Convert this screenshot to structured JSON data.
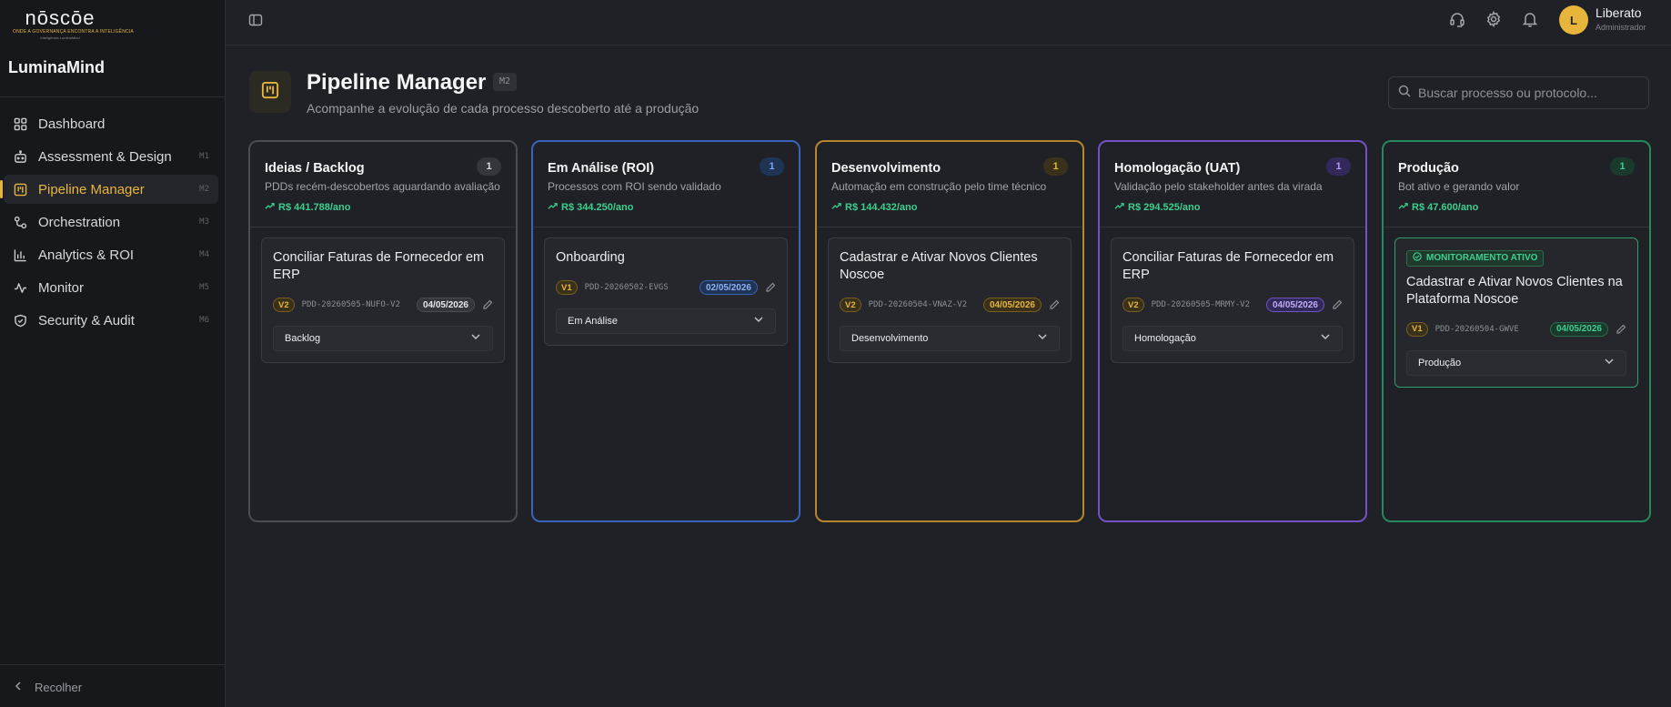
{
  "app": {
    "logo_word": "nōscōe",
    "logo_tagline": "ONDE A GOVERNANÇA ENCONTRA A INTELIGÊNCIA",
    "logo_sub": "Inteligência LuminaMind",
    "brand": "LuminaMind"
  },
  "sidebar": {
    "items": [
      {
        "label": "Dashboard",
        "code": "",
        "icon": "grid-icon"
      },
      {
        "label": "Assessment & Design",
        "code": "M1",
        "icon": "bot-icon"
      },
      {
        "label": "Pipeline Manager",
        "code": "M2",
        "icon": "kanban-icon",
        "active": true
      },
      {
        "label": "Orchestration",
        "code": "M3",
        "icon": "workflow-icon"
      },
      {
        "label": "Analytics & ROI",
        "code": "M4",
        "icon": "bar-chart-icon"
      },
      {
        "label": "Monitor",
        "code": "M5",
        "icon": "activity-icon"
      },
      {
        "label": "Security & Audit",
        "code": "M6",
        "icon": "shield-check-icon"
      }
    ],
    "collapse_label": "Recolher"
  },
  "topbar": {
    "user_initial": "L",
    "user_name": "Liberato",
    "user_role": "Administrador"
  },
  "header": {
    "title": "Pipeline Manager",
    "code": "M2",
    "subtitle": "Acompanhe a evolução de cada processo descoberto até a produção",
    "search_placeholder": "Buscar processo ou protocolo..."
  },
  "columns": [
    {
      "title": "Ideias / Backlog",
      "count": "1",
      "desc": "PDDs recém-descobertos aguardando avaliação",
      "value": "R$ 441.788/ano",
      "border": "#4a4c52",
      "badge_bg": "#34363c",
      "badge_fg": "#d7d9de",
      "card": {
        "tag": "",
        "title": "Conciliar Faturas de Fornecedor em ERP",
        "version": "V2",
        "pdd": "PDD-20260505-NUFO-V2",
        "date": "04/05/2026",
        "stage": "Backlog",
        "date_bg": "#34363c",
        "date_fg": "#e6e7ea",
        "date_border": "#4a4c52"
      }
    },
    {
      "title": "Em Análise (ROI)",
      "count": "1",
      "desc": "Processos com ROI sendo validado",
      "value": "R$ 344.250/ano",
      "border": "#3b64b8",
      "badge_bg": "#1f3355",
      "badge_fg": "#7aa6f2",
      "card": {
        "tag": "",
        "title": "Onboarding",
        "version": "V1",
        "pdd": "PDD-20260502-EVGS",
        "date": "02/05/2026",
        "stage": "Em Análise",
        "date_bg": "#1f3355",
        "date_fg": "#8db3f5",
        "date_border": "#3b64b8"
      }
    },
    {
      "title": "Desenvolvimento",
      "count": "1",
      "desc": "Automação em construção pelo time técnico",
      "value": "R$ 144.432/ano",
      "border": "#b8862a",
      "badge_bg": "#3a311b",
      "badge_fg": "#e8b53b",
      "card": {
        "tag": "",
        "title": "Cadastrar e Ativar Novos Clientes Noscoe",
        "version": "V2",
        "pdd": "PDD-20260504-VNAZ-V2",
        "date": "04/05/2026",
        "stage": "Desenvolvimento",
        "date_bg": "#3a311b",
        "date_fg": "#e8b53b",
        "date_border": "#7a5e21"
      }
    },
    {
      "title": "Homologação (UAT)",
      "count": "1",
      "desc": "Validação pelo stakeholder antes da virada",
      "value": "R$ 294.525/ano",
      "border": "#7452c2",
      "badge_bg": "#32285a",
      "badge_fg": "#b49af2",
      "card": {
        "tag": "",
        "title": "Conciliar Faturas de Fornecedor em ERP",
        "version": "V2",
        "pdd": "PDD-20260505-MRMY-V2",
        "date": "04/05/2026",
        "stage": "Homologação",
        "date_bg": "#32285a",
        "date_fg": "#c2abf5",
        "date_border": "#7452c2"
      }
    },
    {
      "title": "Produção",
      "count": "1",
      "desc": "Bot ativo e gerando valor",
      "value": "R$ 47.600/ano",
      "border": "#24895d",
      "badge_bg": "#1a3a2c",
      "badge_fg": "#3ecf8e",
      "card": {
        "tag": "MONITORAMENTO ATIVO",
        "title": "Cadastrar e Ativar Novos Clientes na Plataforma Noscoe",
        "version": "V1",
        "pdd": "PDD-20260504-GWVE",
        "date": "04/05/2026",
        "stage": "Produção",
        "date_bg": "#1a3a2c",
        "date_fg": "#3ecf8e",
        "date_border": "#2b6b4b"
      }
    }
  ]
}
